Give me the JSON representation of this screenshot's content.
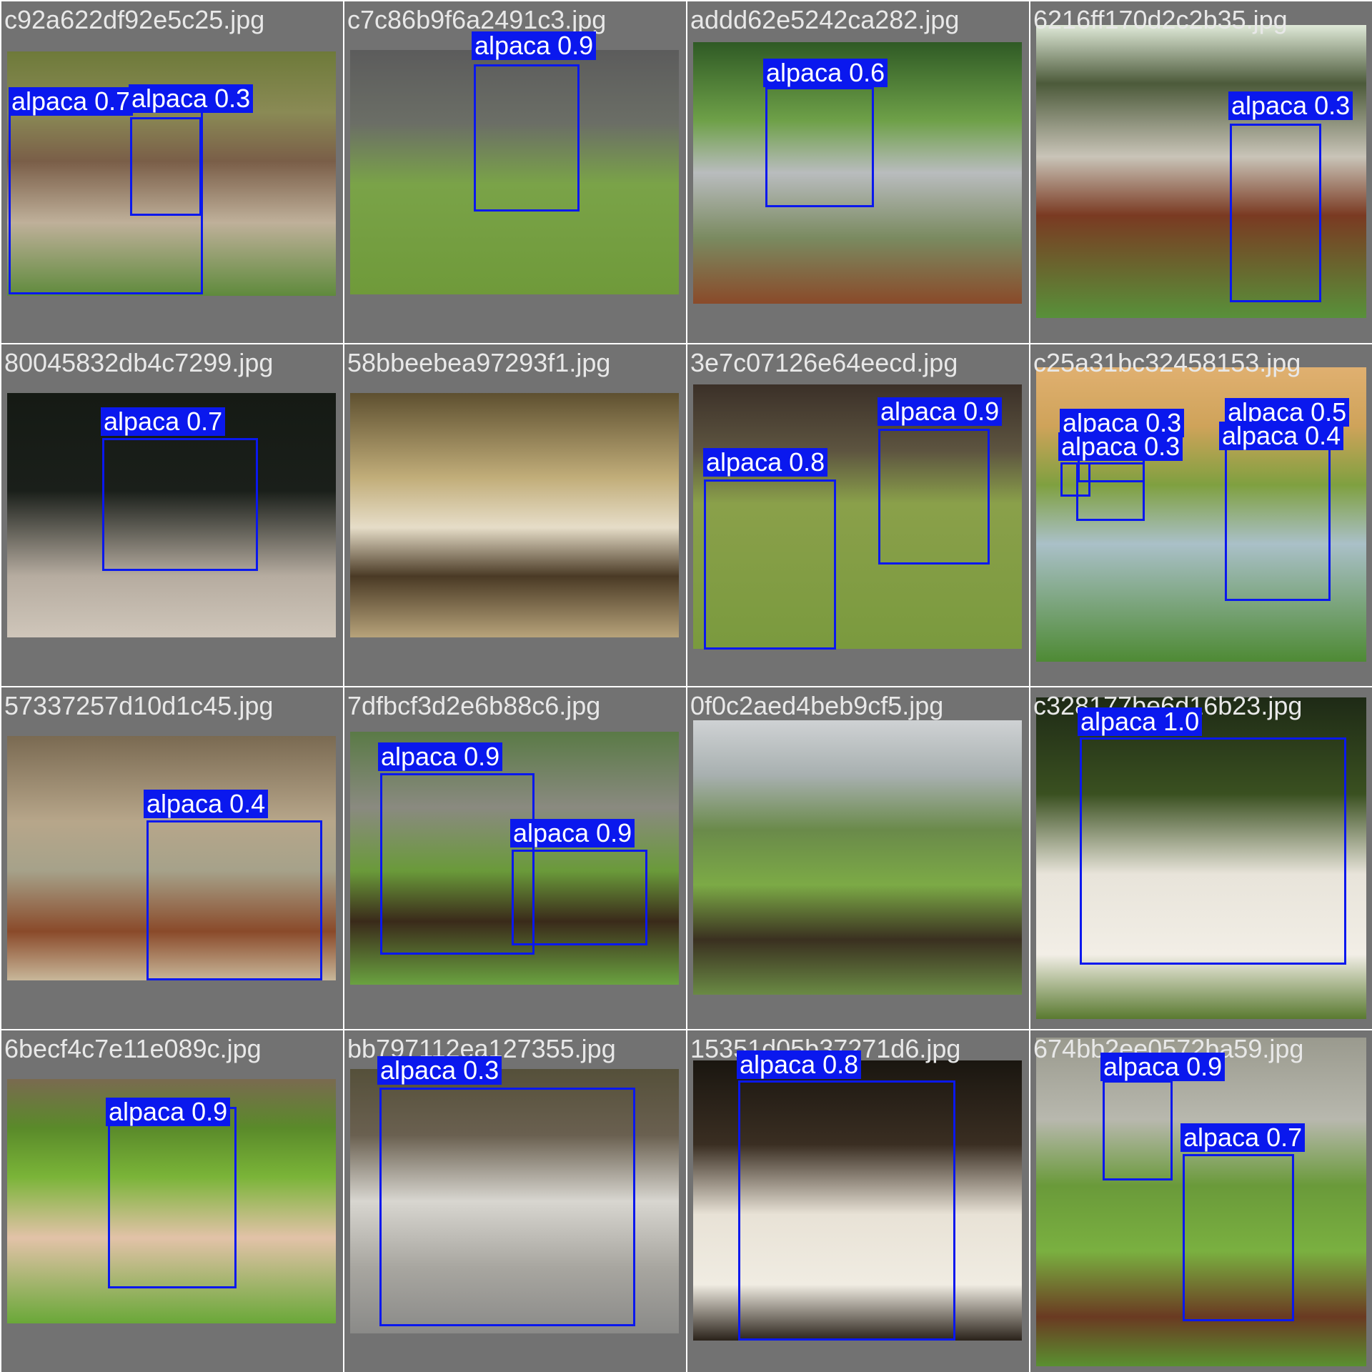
{
  "box_color": "#0a18ee",
  "tiles": [
    {
      "file": "c92a622df92e5c25.jpg",
      "detections": [
        {
          "label": "alpaca 0.7"
        },
        {
          "label": "alpaca 0.3"
        }
      ]
    },
    {
      "file": "c7c86b9f6a2491c3.jpg",
      "detections": [
        {
          "label": "alpaca 0.9"
        }
      ]
    },
    {
      "file": "addd62e5242ca282.jpg",
      "detections": [
        {
          "label": "alpaca 0.6"
        }
      ]
    },
    {
      "file": "6216ff170d2c2b35.jpg",
      "detections": [
        {
          "label": "alpaca 0.3"
        }
      ]
    },
    {
      "file": "80045832db4c7299.jpg",
      "detections": [
        {
          "label": "alpaca 0.7"
        }
      ]
    },
    {
      "file": "58bbeebea97293f1.jpg",
      "detections": []
    },
    {
      "file": "3e7c07126e64eecd.jpg",
      "detections": [
        {
          "label": "alpaca 0.9"
        },
        {
          "label": "alpaca 0.8"
        }
      ]
    },
    {
      "file": "c25a31bc32458153.jpg",
      "detections": [
        {
          "label": "alpaca 0.5"
        },
        {
          "label": "alpaca 0.3"
        },
        {
          "label": "alpaca 0.3"
        },
        {
          "label": "alpaca 0.4"
        }
      ]
    },
    {
      "file": "57337257d10d1c45.jpg",
      "detections": [
        {
          "label": "alpaca 0.4"
        }
      ]
    },
    {
      "file": "7dfbcf3d2e6b88c6.jpg",
      "detections": [
        {
          "label": "alpaca 0.9"
        },
        {
          "label": "alpaca 0.9"
        }
      ]
    },
    {
      "file": "0f0c2aed4beb9cf5.jpg",
      "detections": []
    },
    {
      "file": "c328177be6d16b23.jpg",
      "detections": [
        {
          "label": "alpaca 1.0"
        }
      ]
    },
    {
      "file": "6becf4c7e11e089c.jpg",
      "detections": [
        {
          "label": "alpaca 0.9"
        }
      ]
    },
    {
      "file": "bb797112ea127355.jpg",
      "detections": [
        {
          "label": "alpaca 0.3"
        }
      ]
    },
    {
      "file": "15351d05b37271d6.jpg",
      "detections": [
        {
          "label": "alpaca 0.8"
        }
      ]
    },
    {
      "file": "674bb2ee0572ba59.jpg",
      "detections": [
        {
          "label": "alpaca 0.9"
        },
        {
          "label": "alpaca 0.7"
        }
      ]
    }
  ]
}
